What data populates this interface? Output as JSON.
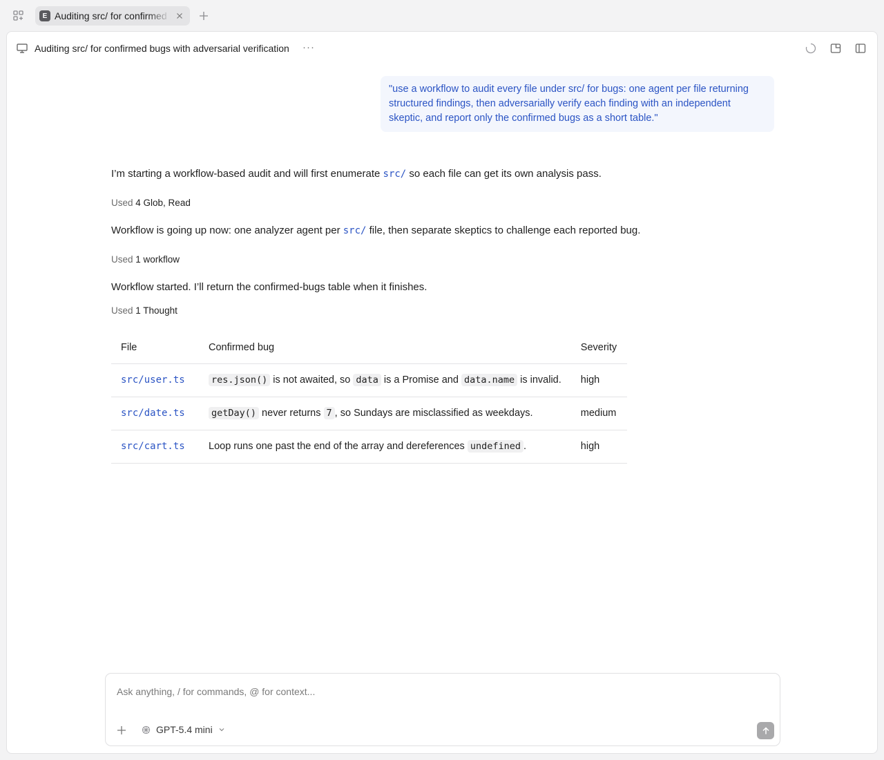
{
  "tab": {
    "badge": "E",
    "title": "Auditing src/ for confirmed bugs with adversarial verification"
  },
  "header": {
    "title": "Auditing src/ for confirmed bugs with adversarial verification",
    "more": "···"
  },
  "user_message": "\"use a workflow to audit every file under src/ for bugs: one agent per file returning structured findings, then adversarially verify each finding with an independent skeptic, and report only the confirmed bugs as a short table.\"",
  "assistant": {
    "p1_before": "I’m starting a workflow-based audit and will first enumerate ",
    "p1_code": "src/",
    "p1_after": " so each file can get its own analysis pass.",
    "used1_label": "Used",
    "used1_value": "4 Glob, Read",
    "p2_before": "Workflow is going up now: one analyzer agent per ",
    "p2_code": "src/",
    "p2_after": " file, then separate skeptics to challenge each reported bug.",
    "used2_label": "Used",
    "used2_value": "1 workflow",
    "p3": "Workflow started. I’ll return the confirmed-bugs table when it finishes.",
    "used3_label": "Used",
    "used3_value": "1 Thought"
  },
  "table": {
    "headers": [
      "File",
      "Confirmed bug",
      "Severity"
    ],
    "rows": [
      {
        "file": "src/user.ts",
        "bug": [
          {
            "code": "res.json()"
          },
          {
            "text": " is not awaited, so "
          },
          {
            "code": "data"
          },
          {
            "text": " is a Promise and "
          },
          {
            "code": "data.name"
          },
          {
            "text": " is invalid."
          }
        ],
        "severity": "high"
      },
      {
        "file": "src/date.ts",
        "bug": [
          {
            "code": "getDay()"
          },
          {
            "text": " never returns "
          },
          {
            "code": "7"
          },
          {
            "text": ", so Sundays are misclassified as weekdays."
          }
        ],
        "severity": "medium"
      },
      {
        "file": "src/cart.ts",
        "bug": [
          {
            "text": "Loop runs one past the end of the array and dereferences "
          },
          {
            "code": "undefined"
          },
          {
            "text": "."
          }
        ],
        "severity": "high"
      }
    ]
  },
  "composer": {
    "placeholder": "Ask anything, / for commands, @ for context...",
    "model": "GPT-5.4 mini"
  }
}
